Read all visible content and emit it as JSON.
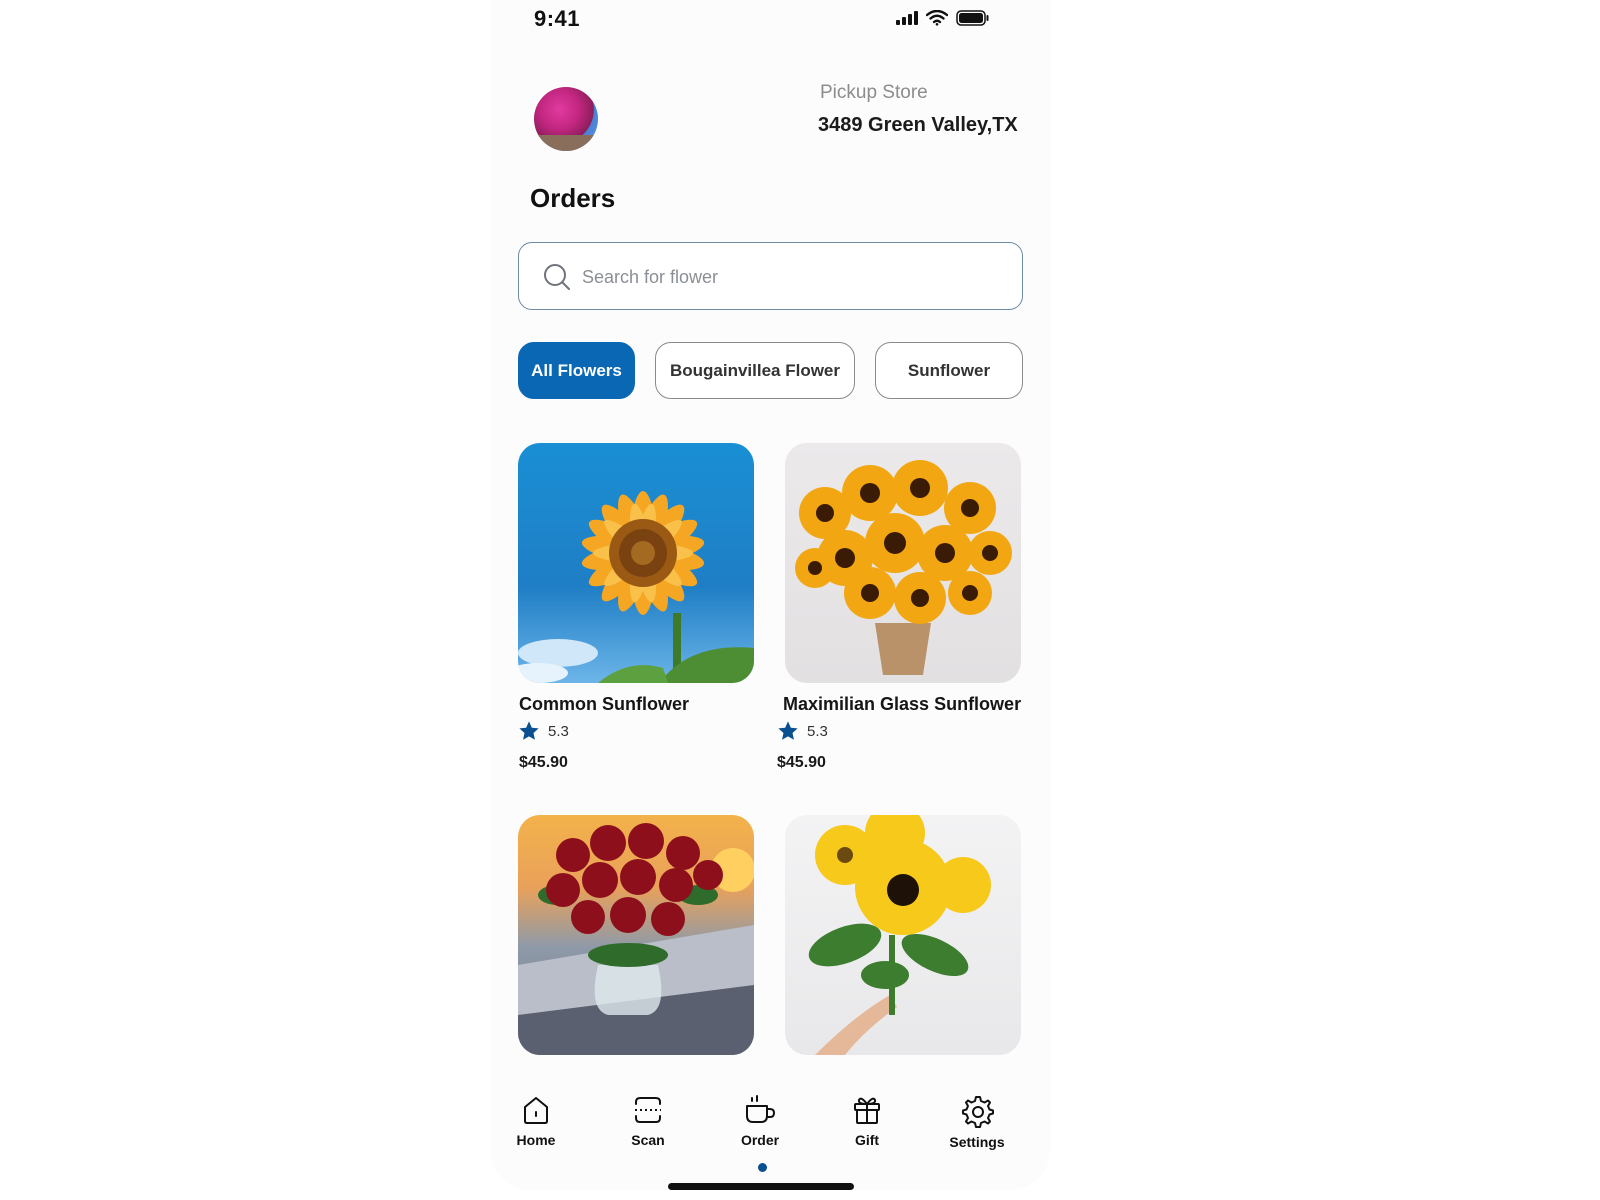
{
  "status_bar": {
    "time": "9:41"
  },
  "header": {
    "store_label": "Pickup Store",
    "store_address": "3489 Green Valley,TX"
  },
  "page": {
    "title": "Orders"
  },
  "search": {
    "placeholder": "Search for flower"
  },
  "filters": [
    {
      "label": "All Flowers",
      "active": true
    },
    {
      "label": "Bougainvillea Flower",
      "active": false
    },
    {
      "label": "Sunflower",
      "active": false
    }
  ],
  "products": [
    {
      "name": "Common Sunflower",
      "rating": "5.3",
      "price": "$45.90"
    },
    {
      "name": "Maximilian Glass Sunflower",
      "rating": "5.3",
      "price": "$45.90"
    },
    {
      "name": "",
      "rating": "",
      "price": ""
    },
    {
      "name": "",
      "rating": "",
      "price": ""
    }
  ],
  "nav": [
    {
      "label": "Home",
      "icon": "home-icon"
    },
    {
      "label": "Scan",
      "icon": "scan-icon"
    },
    {
      "label": "Order",
      "icon": "coffee-cup-icon",
      "active": true
    },
    {
      "label": "Gift",
      "icon": "gift-icon"
    },
    {
      "label": "Settings",
      "icon": "gear-icon"
    }
  ],
  "colors": {
    "accent": "#0a67b4",
    "rating_star": "#0a4f8f",
    "active_dot": "#0a4f8f"
  }
}
